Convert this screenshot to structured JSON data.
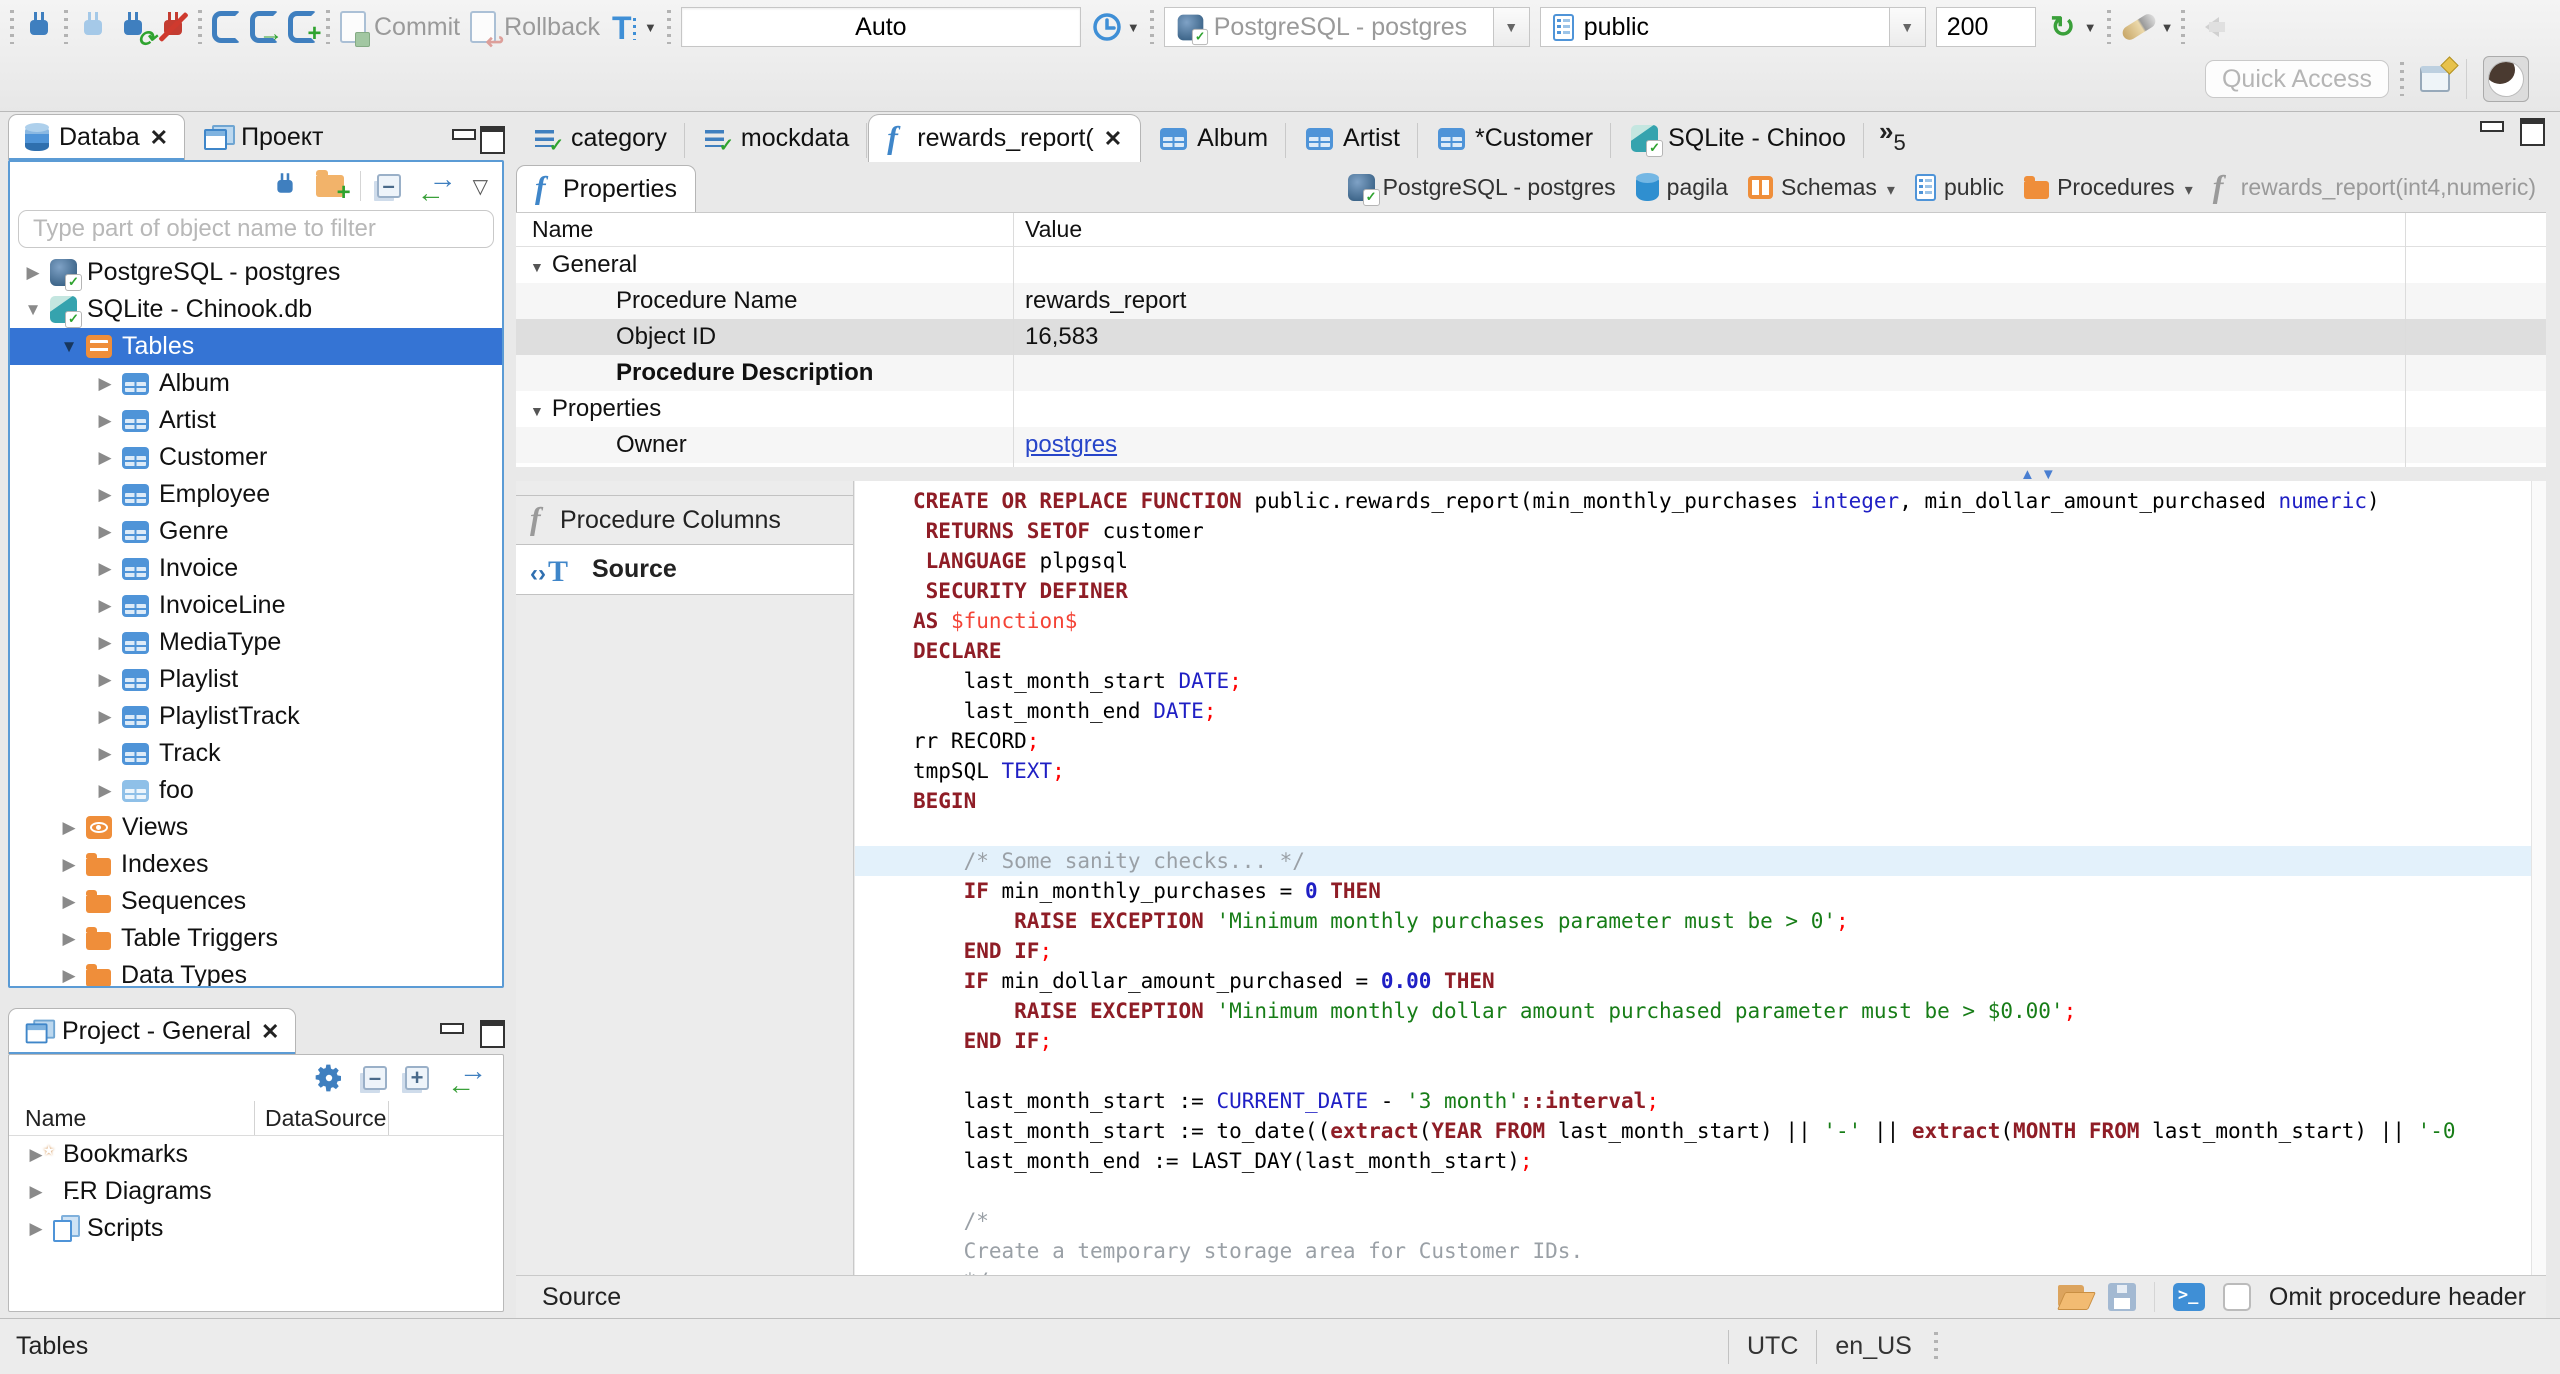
{
  "toolbar": {
    "commit": "Commit",
    "rollback": "Rollback",
    "auto": "Auto",
    "connection": "PostgreSQL - postgres",
    "schema": "public",
    "fetch_size": "200",
    "quick_access": "Quick Access"
  },
  "left_tabs": [
    {
      "label": "Databa",
      "icon": "dbstack",
      "active": true,
      "closable": true
    },
    {
      "label": "Проект",
      "icon": "projects",
      "active": false,
      "closable": false
    }
  ],
  "navigator": {
    "filter_placeholder": "Type part of object name to filter",
    "tree": [
      {
        "label": "PostgreSQL - postgres",
        "icon": "pg",
        "depth": 0,
        "exp": "c",
        "selected": false
      },
      {
        "label": "SQLite - Chinook.db",
        "icon": "sqlite",
        "depth": 0,
        "exp": "e",
        "selected": false
      },
      {
        "label": "Tables",
        "icon": "tablesfolder",
        "depth": 1,
        "exp": "e",
        "selected": true
      },
      {
        "label": "Album",
        "icon": "table",
        "depth": 2,
        "exp": "c",
        "selected": false
      },
      {
        "label": "Artist",
        "icon": "table",
        "depth": 2,
        "exp": "c",
        "selected": false
      },
      {
        "label": "Customer",
        "icon": "table",
        "depth": 2,
        "exp": "c",
        "selected": false
      },
      {
        "label": "Employee",
        "icon": "table",
        "depth": 2,
        "exp": "c",
        "selected": false
      },
      {
        "label": "Genre",
        "icon": "table",
        "depth": 2,
        "exp": "c",
        "selected": false
      },
      {
        "label": "Invoice",
        "icon": "table",
        "depth": 2,
        "exp": "c",
        "selected": false
      },
      {
        "label": "InvoiceLine",
        "icon": "table",
        "depth": 2,
        "exp": "c",
        "selected": false
      },
      {
        "label": "MediaType",
        "icon": "table",
        "depth": 2,
        "exp": "c",
        "selected": false
      },
      {
        "label": "Playlist",
        "icon": "table",
        "depth": 2,
        "exp": "c",
        "selected": false
      },
      {
        "label": "PlaylistTrack",
        "icon": "table",
        "depth": 2,
        "exp": "c",
        "selected": false
      },
      {
        "label": "Track",
        "icon": "table",
        "depth": 2,
        "exp": "c",
        "selected": false
      },
      {
        "label": "foo",
        "icon": "tablelight",
        "depth": 2,
        "exp": "c",
        "selected": false
      },
      {
        "label": "Views",
        "icon": "views",
        "depth": 1,
        "exp": "c",
        "selected": false
      },
      {
        "label": "Indexes",
        "icon": "folder",
        "depth": 1,
        "exp": "c",
        "selected": false
      },
      {
        "label": "Sequences",
        "icon": "folder",
        "depth": 1,
        "exp": "c",
        "selected": false
      },
      {
        "label": "Table Triggers",
        "icon": "folder",
        "depth": 1,
        "exp": "c",
        "selected": false
      },
      {
        "label": "Data Types",
        "icon": "folder",
        "depth": 1,
        "exp": "c",
        "selected": false
      }
    ]
  },
  "project_panel": {
    "title": "Project - General",
    "columns": [
      "Name",
      "DataSource"
    ],
    "items": [
      {
        "label": "Bookmarks",
        "icon": "bookmarks"
      },
      {
        "label": "ER Diagrams",
        "icon": "erd"
      },
      {
        "label": "Scripts",
        "icon": "scripts"
      }
    ]
  },
  "editor_tabs": {
    "tabs": [
      {
        "label": "category",
        "icon": "script",
        "active": false,
        "closable": false
      },
      {
        "label": "mockdata",
        "icon": "script",
        "active": false,
        "closable": false
      },
      {
        "label": "rewards_report(",
        "icon": "fn",
        "active": true,
        "closable": true
      },
      {
        "label": "Album",
        "icon": "table",
        "active": false,
        "closable": false
      },
      {
        "label": "Artist",
        "icon": "table",
        "active": false,
        "closable": false
      },
      {
        "label": "*Customer",
        "icon": "table",
        "active": false,
        "closable": false
      },
      {
        "label": "SQLite - Chinoo",
        "icon": "sqlite",
        "active": false,
        "closable": false
      }
    ],
    "more_count": "5"
  },
  "properties_view": {
    "tab": "Properties",
    "breadcrumb": [
      {
        "label": "PostgreSQL - postgres",
        "icon": "pg",
        "dropdown": false,
        "dim": false
      },
      {
        "label": "pagila",
        "icon": "db",
        "dropdown": false,
        "dim": false
      },
      {
        "label": "Schemas",
        "icon": "schemas",
        "dropdown": true,
        "dim": false
      },
      {
        "label": "public",
        "icon": "doc",
        "dropdown": false,
        "dim": false
      },
      {
        "label": "Procedures",
        "icon": "folder",
        "dropdown": true,
        "dim": false
      },
      {
        "label": "rewards_report(int4,numeric)",
        "icon": "fngrey",
        "dropdown": false,
        "dim": true
      }
    ],
    "columns": [
      "Name",
      "Value"
    ],
    "rows": [
      {
        "name": "General",
        "value": "",
        "group": true,
        "shade": false,
        "selected": false,
        "bold": false,
        "link": false
      },
      {
        "name": "Procedure Name",
        "value": "rewards_report",
        "group": false,
        "shade": true,
        "selected": false,
        "bold": false,
        "link": false
      },
      {
        "name": "Object ID",
        "value": "16,583",
        "group": false,
        "shade": false,
        "selected": true,
        "bold": false,
        "link": false
      },
      {
        "name": "Procedure Description",
        "value": "",
        "group": false,
        "shade": true,
        "selected": false,
        "bold": true,
        "link": false
      },
      {
        "name": "Properties",
        "value": "",
        "group": true,
        "shade": false,
        "selected": false,
        "bold": false,
        "link": false
      },
      {
        "name": "Owner",
        "value": "postgres",
        "group": false,
        "shade": true,
        "selected": false,
        "bold": false,
        "link": true
      }
    ]
  },
  "subtabs": [
    {
      "label": "Procedure Columns",
      "icon": "fngrey",
      "active": false
    },
    {
      "label": "Source",
      "icon": "srct",
      "active": true
    }
  ],
  "source_editor": {
    "highlighted_line": 12,
    "lines": [
      [
        [
          "k",
          "CREATE OR REPLACE FUNCTION "
        ],
        [
          "d",
          "public.rewards_report(min_monthly_purchases "
        ],
        [
          "t",
          "integer"
        ],
        [
          "d",
          ", min_dollar_amount_purchased "
        ],
        [
          "t",
          "numeric"
        ],
        [
          "d",
          ")"
        ]
      ],
      [
        [
          "d",
          " "
        ],
        [
          "k",
          "RETURNS SETOF"
        ],
        [
          "d",
          " customer"
        ]
      ],
      [
        [
          "d",
          " "
        ],
        [
          "k",
          "LANGUAGE"
        ],
        [
          "d",
          " plpgsql"
        ]
      ],
      [
        [
          "d",
          " "
        ],
        [
          "k",
          "SECURITY DEFINER"
        ]
      ],
      [
        [
          "k",
          "AS "
        ],
        [
          "r",
          "$function$"
        ]
      ],
      [
        [
          "k",
          "DECLARE"
        ]
      ],
      [
        [
          "d",
          "    last_month_start "
        ],
        [
          "t",
          "DATE"
        ],
        [
          "p",
          ";"
        ]
      ],
      [
        [
          "d",
          "    last_month_end "
        ],
        [
          "t",
          "DATE"
        ],
        [
          "p",
          ";"
        ]
      ],
      [
        [
          "d",
          "rr RECORD"
        ],
        [
          "p",
          ";"
        ]
      ],
      [
        [
          "d",
          "tmpSQL "
        ],
        [
          "t",
          "TEXT"
        ],
        [
          "p",
          ";"
        ]
      ],
      [
        [
          "k",
          "BEGIN"
        ]
      ],
      [],
      [
        [
          "c",
          "    /* Some sanity checks... */"
        ]
      ],
      [
        [
          "d",
          "    "
        ],
        [
          "k",
          "IF"
        ],
        [
          "d",
          " min_monthly_purchases = "
        ],
        [
          "n",
          "0"
        ],
        [
          "d",
          " "
        ],
        [
          "k",
          "THEN"
        ]
      ],
      [
        [
          "d",
          "        "
        ],
        [
          "k",
          "RAISE EXCEPTION"
        ],
        [
          "d",
          " "
        ],
        [
          "s",
          "'Minimum monthly purchases parameter must be > 0'"
        ],
        [
          "p",
          ";"
        ]
      ],
      [
        [
          "d",
          "    "
        ],
        [
          "k",
          "END IF"
        ],
        [
          "p",
          ";"
        ]
      ],
      [
        [
          "d",
          "    "
        ],
        [
          "k",
          "IF"
        ],
        [
          "d",
          " min_dollar_amount_purchased = "
        ],
        [
          "n",
          "0.00"
        ],
        [
          "d",
          " "
        ],
        [
          "k",
          "THEN"
        ]
      ],
      [
        [
          "d",
          "        "
        ],
        [
          "k",
          "RAISE EXCEPTION"
        ],
        [
          "d",
          " "
        ],
        [
          "s",
          "'Minimum monthly dollar amount purchased parameter must be > $0.00'"
        ],
        [
          "p",
          ";"
        ]
      ],
      [
        [
          "d",
          "    "
        ],
        [
          "k",
          "END IF"
        ],
        [
          "p",
          ";"
        ]
      ],
      [],
      [
        [
          "d",
          "    last_month_start := "
        ],
        [
          "t",
          "CURRENT_DATE"
        ],
        [
          "d",
          " - "
        ],
        [
          "s",
          "'3 month'"
        ],
        [
          "k",
          "::interval"
        ],
        [
          "p",
          ";"
        ]
      ],
      [
        [
          "d",
          "    last_month_start := to_date(("
        ],
        [
          "k",
          "extract"
        ],
        [
          "d",
          "("
        ],
        [
          "k",
          "YEAR FROM"
        ],
        [
          "d",
          " last_month_start) || "
        ],
        [
          "s",
          "'-'"
        ],
        [
          "d",
          " || "
        ],
        [
          "k",
          "extract"
        ],
        [
          "d",
          "("
        ],
        [
          "k",
          "MONTH FROM"
        ],
        [
          "d",
          " last_month_start) || "
        ],
        [
          "s",
          "'-0"
        ]
      ],
      [
        [
          "d",
          "    last_month_end := LAST_DAY(last_month_start)"
        ],
        [
          "p",
          ";"
        ]
      ],
      [],
      [
        [
          "c",
          "    /*"
        ]
      ],
      [
        [
          "c",
          "    Create a temporary storage area for Customer IDs."
        ]
      ],
      [
        [
          "c",
          "    */"
        ]
      ]
    ]
  },
  "editor_footer": {
    "label": "Source",
    "omit_checkbox": "Omit procedure header"
  },
  "status_bar": {
    "left": "Tables",
    "timezone": "UTC",
    "locale": "en_US"
  }
}
